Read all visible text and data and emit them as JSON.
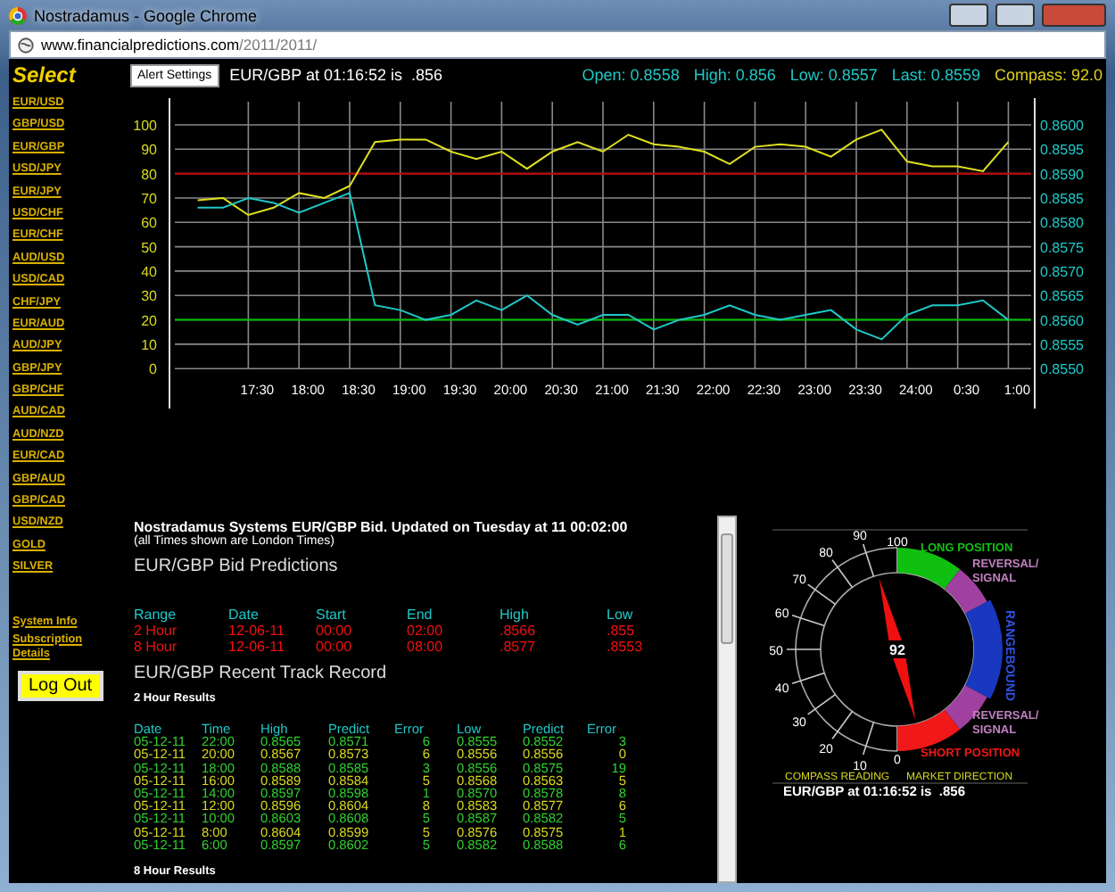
{
  "window": {
    "title": "Nostradamus - Google Chrome",
    "url_host": "www.financialpredictions.com",
    "url_path": "/2011/2011/"
  },
  "sidebar": {
    "title": "Select",
    "pairs": [
      "EUR/USD",
      "GBP/USD",
      "EUR/GBP",
      "USD/JPY",
      "EUR/JPY",
      "USD/CHF",
      "EUR/CHF",
      "AUD/USD",
      "USD/CAD",
      "CHF/JPY",
      "EUR/AUD",
      "AUD/JPY",
      "GBP/JPY",
      "GBP/CHF",
      "AUD/CAD",
      "AUD/NZD",
      "EUR/CAD",
      "GBP/AUD",
      "GBP/CAD",
      "USD/NZD",
      "GOLD",
      "SILVER"
    ],
    "links": [
      "System Info",
      "Subscription Details"
    ],
    "logout": "Log Out"
  },
  "header": {
    "alert_button": "Alert Settings",
    "quote": "EUR/GBP at 01:16:52 is  .856",
    "stats": [
      {
        "kind": "price",
        "text": "Open: 0.8558"
      },
      {
        "kind": "price",
        "text": "High: 0.856"
      },
      {
        "kind": "price",
        "text": "Low: 0.8557"
      },
      {
        "kind": "price",
        "text": "Last: 0.8559"
      },
      {
        "kind": "compass",
        "text": "Compass: 92.0"
      }
    ]
  },
  "chart": {
    "chart_data": {
      "type": "line",
      "ylim": [
        0,
        100
      ],
      "categories": [
        null,
        null,
        "17:30",
        null,
        "18:00",
        null,
        "18:30",
        null,
        "19:00",
        null,
        "19:30",
        null,
        "20:00",
        null,
        "20:30",
        null,
        "21:00",
        null,
        "21:30",
        null,
        "22:00",
        null,
        "22:30",
        null,
        "23:00",
        null,
        "23:30",
        null,
        "24:00",
        null,
        "0:30",
        null,
        "1:00"
      ],
      "series": [
        {
          "color": "#e0e020",
          "values": [
            69,
            70,
            63,
            66,
            72,
            70,
            75,
            93,
            94,
            94,
            89,
            86,
            89,
            82,
            89,
            93,
            89,
            96,
            92,
            91,
            89,
            84,
            91,
            92,
            91,
            87,
            94,
            98,
            85,
            83,
            83,
            81,
            93
          ]
        },
        {
          "color": "#20c8c8",
          "axis": "y2",
          "values": [
            0.8583,
            0.8583,
            0.8585,
            0.8584,
            0.8582,
            0.8584,
            0.8586,
            0.8563,
            0.8562,
            0.856,
            0.8561,
            0.8564,
            0.8562,
            0.8565,
            0.8561,
            0.8559,
            0.8561,
            0.8561,
            0.8558,
            0.856,
            0.8561,
            0.8563,
            0.8561,
            0.856,
            0.8561,
            0.8562,
            0.8558,
            0.8556,
            0.8561,
            0.8563,
            0.8563,
            0.8564,
            0.856
          ]
        }
      ],
      "yticks": [
        0,
        10,
        20,
        30,
        40,
        50,
        60,
        70,
        80,
        90,
        100
      ],
      "y2lim": [
        0.855,
        0.86
      ],
      "y2ticks": [
        {
          "value": 0.855,
          "label": "0.8550"
        },
        {
          "value": 0.8555,
          "label": "0.8555"
        },
        {
          "value": 0.856,
          "label": "0.8560"
        },
        {
          "value": 0.8565,
          "label": "0.8565"
        },
        {
          "value": 0.857,
          "label": "0.8570"
        },
        {
          "value": 0.8575,
          "label": "0.8575"
        },
        {
          "value": 0.858,
          "label": "0.8580"
        },
        {
          "value": 0.8585,
          "label": "0.8585"
        },
        {
          "value": 0.859,
          "label": "0.8590"
        },
        {
          "value": 0.8595,
          "label": "0.8595"
        },
        {
          "value": 0.86,
          "label": "0.8600"
        }
      ],
      "grid": true,
      "ref_lines": [
        {
          "axis": "y",
          "value": 80,
          "color": "#c00000"
        },
        {
          "axis": "y",
          "value": 20,
          "color": "#00c000"
        }
      ]
    }
  },
  "report": {
    "title": "Nostradamus Systems EUR/GBP Bid. Updated on Tuesday at 11 00:02:00",
    "note": "(all Times shown are London Times)",
    "predictions_heading": "EUR/GBP Bid Predictions",
    "predictions_columns": [
      "Range",
      "Date",
      "Start",
      "End",
      "High",
      "Low"
    ],
    "predictions_rows": [
      [
        "2 Hour",
        "12-06-11",
        "00:00",
        "02:00",
        ".8566",
        ".855"
      ],
      [
        "8 Hour",
        "12-06-11",
        "00:00",
        "08:00",
        ".8577",
        ".8553"
      ]
    ],
    "track_heading": "EUR/GBP Recent Track Record",
    "results_2h": "2 Hour Results",
    "track_columns": [
      "Date",
      "Time",
      "High",
      "Predict",
      "Error",
      "Low",
      "Predict",
      "Error"
    ],
    "track_rows": [
      {
        "color": "#30d030",
        "cells": [
          "05-12-11",
          "22:00",
          "0.8565",
          "0.8571",
          "6",
          "0.8555",
          "0.8552",
          "3"
        ]
      },
      {
        "color": "#d8d820",
        "cells": [
          "05-12-11",
          "20:00",
          "0.8567",
          "0.8573",
          "6",
          "0.8556",
          "0.8556",
          "0"
        ]
      },
      {
        "color": "#30d030",
        "cells": [
          "05-12-11",
          "18:00",
          "0.8588",
          "0.8585",
          "3",
          "0.8556",
          "0.8575",
          "19"
        ]
      },
      {
        "color": "#d8d820",
        "cells": [
          "05-12-11",
          "16:00",
          "0.8589",
          "0.8584",
          "5",
          "0.8568",
          "0.8563",
          "5"
        ]
      },
      {
        "color": "#30d030",
        "cells": [
          "05-12-11",
          "14:00",
          "0.8597",
          "0.8598",
          "1",
          "0.8570",
          "0.8578",
          "8"
        ]
      },
      {
        "color": "#d8d820",
        "cells": [
          "05-12-11",
          "12:00",
          "0.8596",
          "0.8604",
          "8",
          "0.8583",
          "0.8577",
          "6"
        ]
      },
      {
        "color": "#30d030",
        "cells": [
          "05-12-11",
          "10:00",
          "0.8603",
          "0.8608",
          "5",
          "0.8587",
          "0.8582",
          "5"
        ]
      },
      {
        "color": "#d8d820",
        "cells": [
          "05-12-11",
          "8:00",
          "0.8604",
          "0.8599",
          "5",
          "0.8576",
          "0.8575",
          "1"
        ]
      },
      {
        "color": "#30d030",
        "cells": [
          "05-12-11",
          "6:00",
          "0.8597",
          "0.8602",
          "5",
          "0.8582",
          "0.8588",
          "6"
        ]
      }
    ],
    "results_8h": "8 Hour Results"
  },
  "compass": {
    "scale": [
      "100",
      "90",
      "80",
      "70",
      "60",
      "50",
      "40",
      "30",
      "20",
      "10",
      "0"
    ],
    "reading": "92",
    "zones": [
      {
        "label": "LONG POSITION",
        "color": "#10c010"
      },
      {
        "label": "REVERSAL/ SIGNAL",
        "color": "#a040a0"
      },
      {
        "label": "RANGEBOUND",
        "color": "#1838c0"
      },
      {
        "label": "REVERSAL/ SIGNAL",
        "color": "#a040a0"
      },
      {
        "label": "SHORT POSITION",
        "color": "#f01818"
      }
    ],
    "captions": [
      "COMPASS READING",
      "MARKET DIRECTION"
    ],
    "quote": "EUR/GBP at 01:16:52 is  .856"
  }
}
